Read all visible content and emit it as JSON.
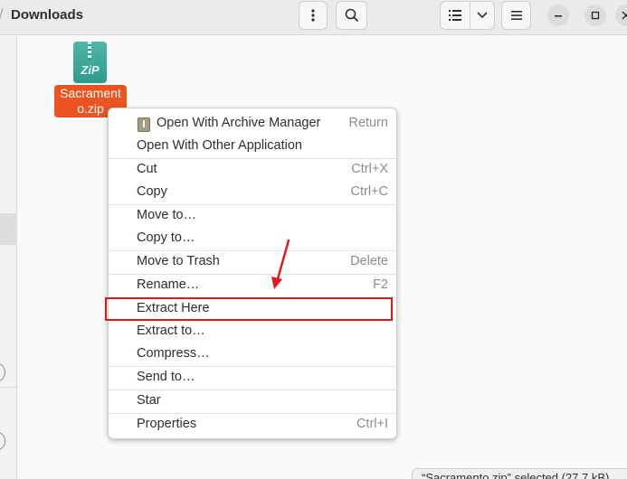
{
  "header": {
    "title": "Downloads",
    "icons": {
      "more": "vertical-dots-icon",
      "search": "search-icon",
      "view": "list-view-icon",
      "view_dropdown": "chevron-down-icon",
      "menu": "hamburger-menu-icon",
      "minimize": "minimize-icon",
      "maximize": "maximize-icon",
      "close": "close-icon"
    }
  },
  "file": {
    "icon_text": "ZiP",
    "name_line1": "Sacrament",
    "name_line2": "o.zip"
  },
  "context_menu": {
    "items": [
      {
        "label": "Open With Archive Manager",
        "accel": "Return"
      },
      {
        "label": "Open With Other Application",
        "accel": ""
      },
      {
        "label": "Cut",
        "accel": "Ctrl+X"
      },
      {
        "label": "Copy",
        "accel": "Ctrl+C"
      },
      {
        "label": "Move to…",
        "accel": ""
      },
      {
        "label": "Copy to…",
        "accel": ""
      },
      {
        "label": "Move to Trash",
        "accel": "Delete"
      },
      {
        "label": "Rename…",
        "accel": "F2"
      },
      {
        "label": "Extract Here",
        "accel": ""
      },
      {
        "label": "Extract to…",
        "accel": ""
      },
      {
        "label": "Compress…",
        "accel": ""
      },
      {
        "label": "Send to…",
        "accel": ""
      },
      {
        "label": "Star",
        "accel": ""
      },
      {
        "label": "Properties",
        "accel": "Ctrl+I"
      }
    ]
  },
  "status": {
    "text": "“Sacramento.zip” selected  (27.7 kB)"
  },
  "colors": {
    "accent": "#e95420",
    "highlight": "#e0191e"
  }
}
